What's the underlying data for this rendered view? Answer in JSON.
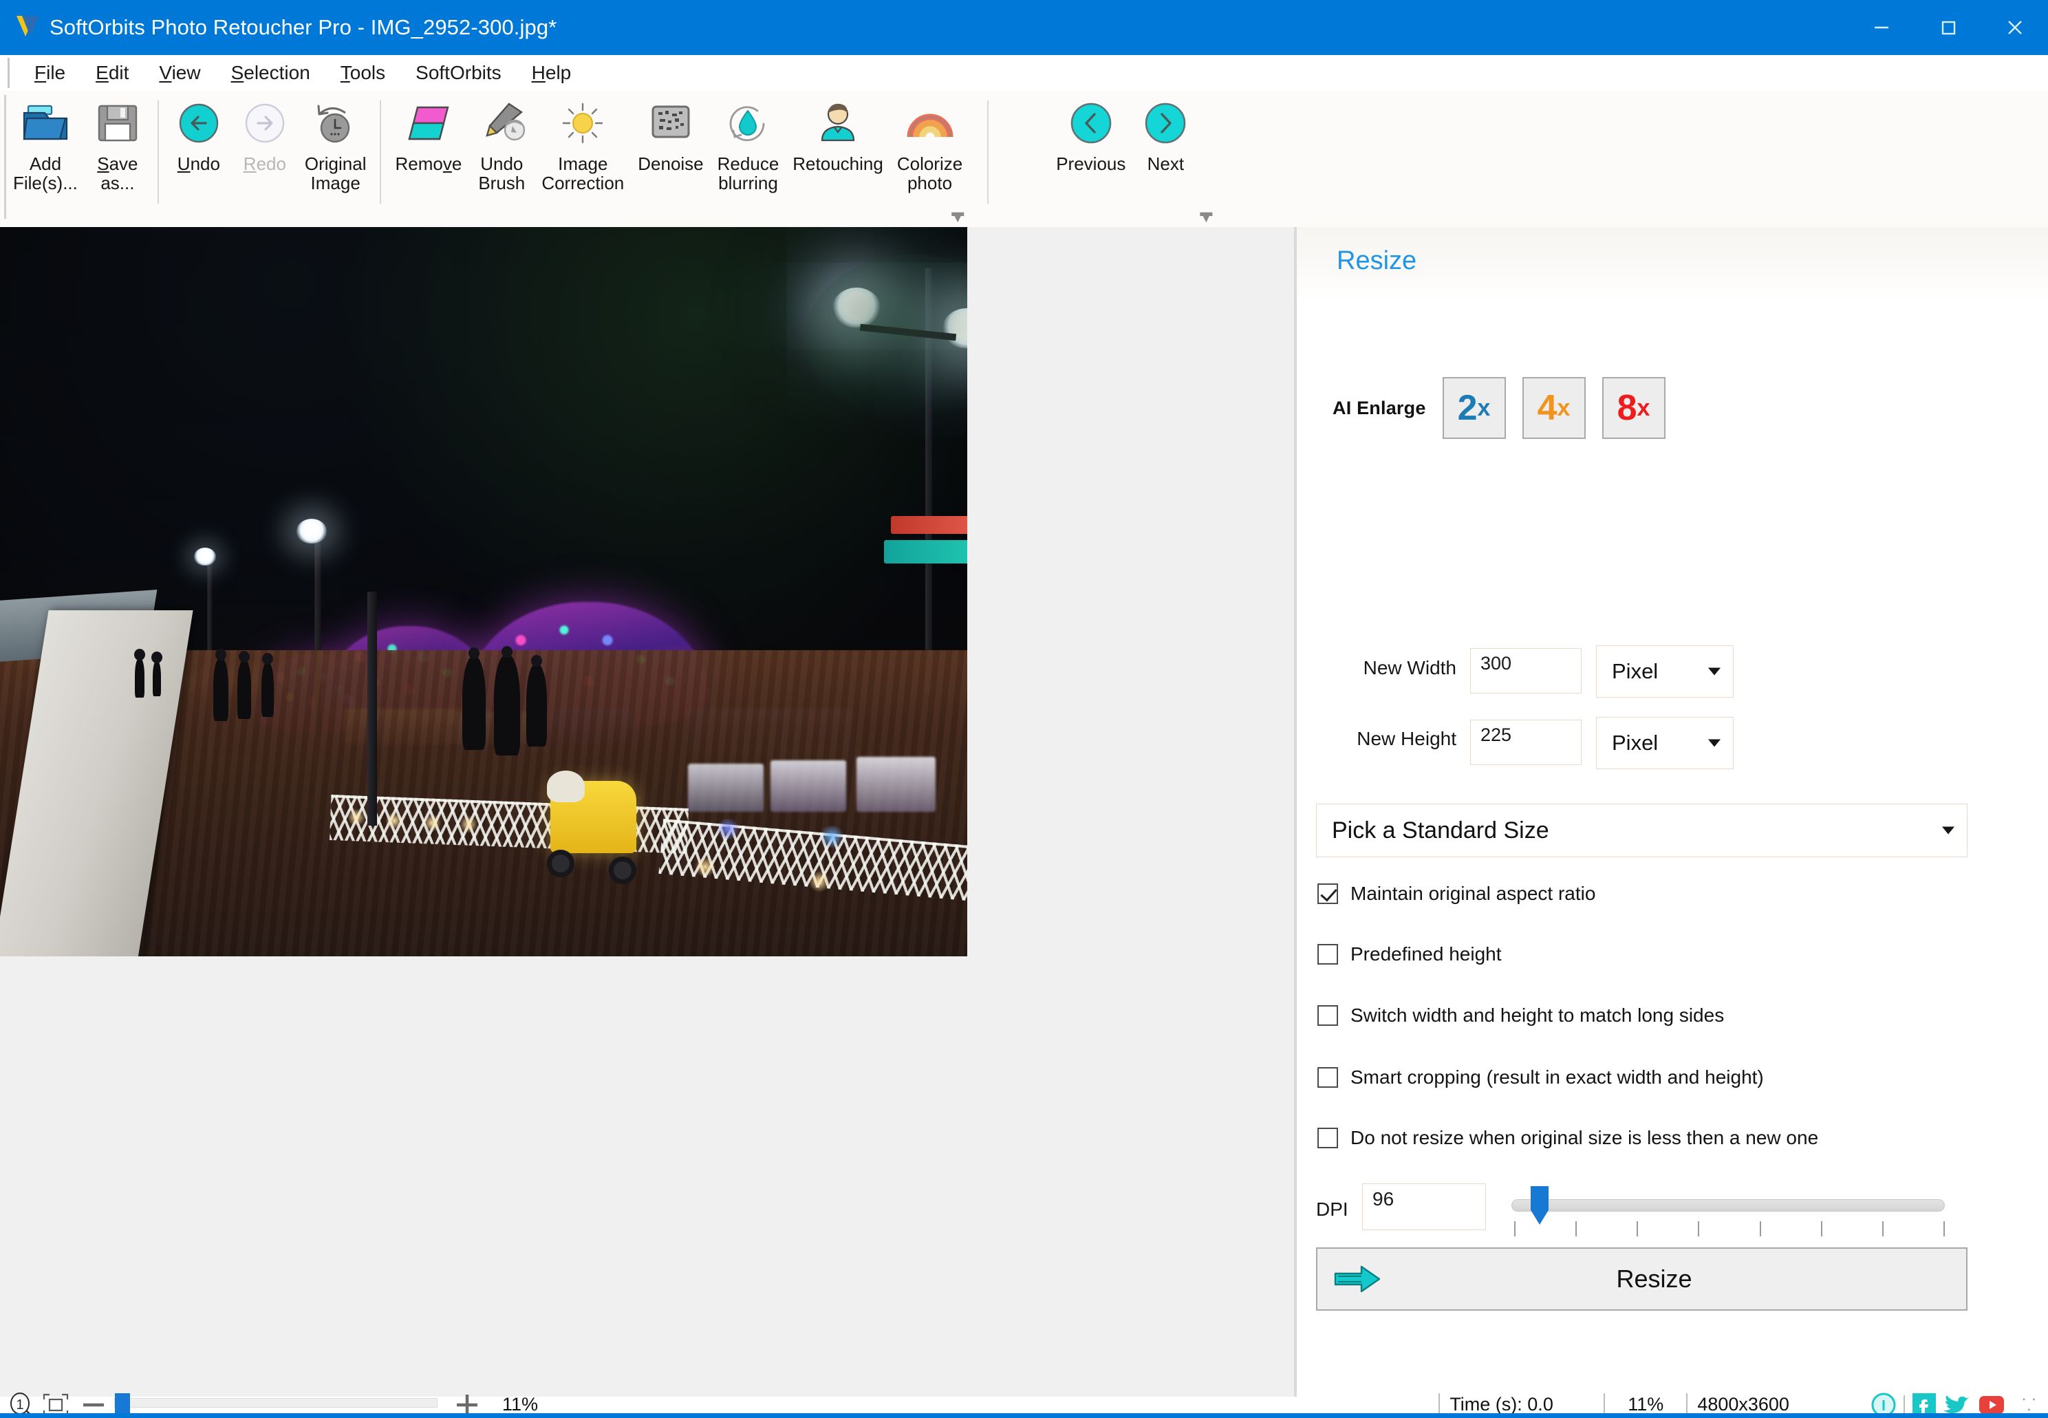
{
  "window": {
    "title": "SoftOrbits Photo Retoucher Pro - IMG_2952-300.jpg*",
    "app_icon": "softorbits-logo-icon",
    "controls": {
      "minimize": "minimize-icon",
      "maximize": "maximize-icon",
      "close": "close-icon"
    }
  },
  "menu": [
    {
      "label": "File",
      "accel": "F"
    },
    {
      "label": "Edit",
      "accel": "E"
    },
    {
      "label": "View",
      "accel": "V"
    },
    {
      "label": "Selection",
      "accel": "S"
    },
    {
      "label": "Tools",
      "accel": "T"
    },
    {
      "label": "SoftOrbits",
      "accel": ""
    },
    {
      "label": "Help",
      "accel": "H"
    }
  ],
  "toolbar": {
    "groups": [
      {
        "items": [
          {
            "name": "add-files",
            "label": "Add\nFile(s)...",
            "icon": "open-folder-icon",
            "disabled": false
          },
          {
            "name": "save-as",
            "label": "Save\nas...",
            "icon": "floppy-disk-icon",
            "disabled": false
          }
        ]
      },
      {
        "items": [
          {
            "name": "undo",
            "label": "Undo",
            "icon": "undo-arrow-icon",
            "disabled": false
          },
          {
            "name": "redo",
            "label": "Redo",
            "icon": "redo-arrow-icon",
            "disabled": true
          },
          {
            "name": "original-image",
            "label": "Original\nImage",
            "icon": "clock-revert-icon",
            "disabled": false
          }
        ]
      },
      {
        "items": [
          {
            "name": "remove",
            "label": "Remove",
            "icon": "eraser-icon",
            "disabled": false
          },
          {
            "name": "undo-brush",
            "label": "Undo\nBrush",
            "icon": "brush-icon",
            "disabled": false
          },
          {
            "name": "image-correction",
            "label": "Image\nCorrection",
            "icon": "sun-icon",
            "disabled": false
          },
          {
            "name": "denoise",
            "label": "Denoise",
            "icon": "noise-square-icon",
            "disabled": false
          },
          {
            "name": "reduce-blurring",
            "label": "Reduce\nblurring",
            "icon": "droplet-refresh-icon",
            "disabled": false
          },
          {
            "name": "retouching",
            "label": "Retouching",
            "icon": "person-icon",
            "disabled": false
          },
          {
            "name": "colorize-photo",
            "label": "Colorize\nphoto",
            "icon": "rainbow-icon",
            "disabled": false
          }
        ]
      },
      {
        "items": [
          {
            "name": "previous",
            "label": "Previous",
            "icon": "chevron-left-circle-icon",
            "disabled": false
          },
          {
            "name": "next",
            "label": "Next",
            "icon": "chevron-right-circle-icon",
            "disabled": false
          }
        ]
      }
    ],
    "overflow_icon": "toolbar-overflow-icon"
  },
  "panel": {
    "title": "Resize",
    "ai_enlarge": {
      "label": "AI Enlarge",
      "buttons": [
        {
          "name": "ai-2x",
          "num": "2",
          "suffix": "x",
          "color": "#1c7cb5"
        },
        {
          "name": "ai-4x",
          "num": "4",
          "suffix": "x",
          "color": "#f0941e"
        },
        {
          "name": "ai-8x",
          "num": "8",
          "suffix": "x",
          "color": "#ee1c1c"
        }
      ]
    },
    "new_width": {
      "label": "New Width",
      "value": "300",
      "unit": "Pixel"
    },
    "new_height": {
      "label": "New Height",
      "value": "225",
      "unit": "Pixel"
    },
    "standard_size": {
      "value": "Pick a Standard Size"
    },
    "checkboxes": [
      {
        "name": "maintain-aspect-ratio",
        "label": "Maintain original aspect ratio",
        "checked": true
      },
      {
        "name": "predefined-height",
        "label": "Predefined height",
        "checked": false
      },
      {
        "name": "switch-width-height",
        "label": "Switch width and height to match long sides",
        "checked": false
      },
      {
        "name": "smart-cropping",
        "label": "Smart cropping (result in exact width and height)",
        "checked": false
      },
      {
        "name": "no-resize-when-smaller",
        "label": "Do not resize when original size is less then a new one",
        "checked": false
      }
    ],
    "dpi": {
      "label": "DPI",
      "value": "96"
    },
    "resize_button": {
      "label": "Resize",
      "icon": "right-arrow-icon"
    }
  },
  "statusbar": {
    "zoom_1to1_icon": "zoom-actual-size-icon",
    "fit_icon": "fit-to-window-icon",
    "minus_icon": "zoom-out-icon",
    "plus_icon": "zoom-in-icon",
    "zoom_percent": "11%",
    "time": "Time (s): 0.0",
    "zoom_percent_right": "11%",
    "dimensions": "4800x3600",
    "social": [
      {
        "name": "info-icon",
        "glyph": "i",
        "color": "#19c7c7"
      },
      {
        "name": "facebook-icon",
        "glyph": "f",
        "color": "#19c7c7"
      },
      {
        "name": "twitter-icon",
        "glyph": "t",
        "color": "#19c7c7"
      },
      {
        "name": "youtube-icon",
        "glyph": "y",
        "color": "#e8413c"
      }
    ]
  },
  "canvas": {
    "image_name": "night-promenade-photo"
  }
}
